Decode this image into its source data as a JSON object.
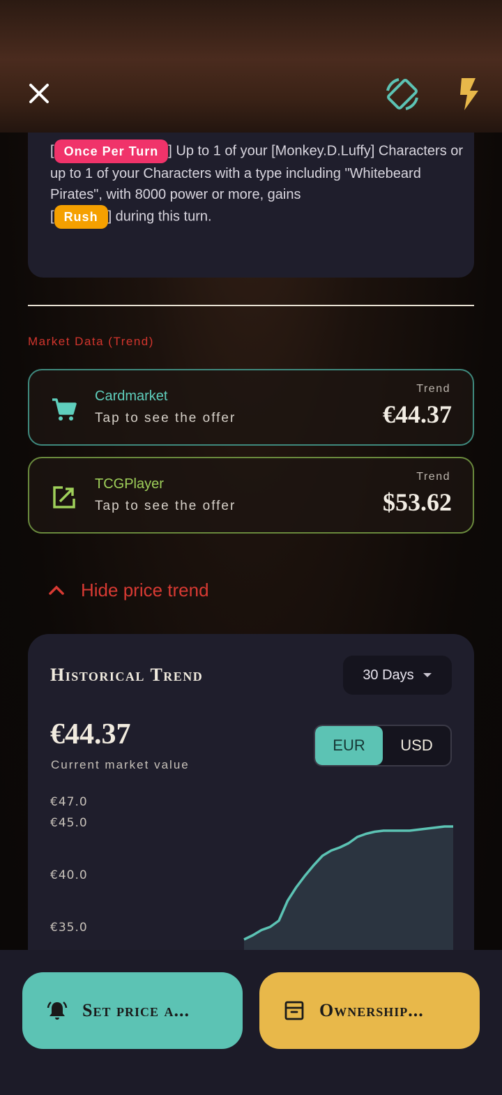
{
  "header": {
    "close_icon": "close-icon",
    "rotate_icon": "screen-rotation-icon",
    "flash_icon": "flash-icon"
  },
  "effect": {
    "tag1": "Once Per Turn",
    "text1": "] Up to 1 of your [Monkey.D.Luffy] Characters or up to 1 of your Characters with a type including \"Whitebeard Pirates\", with 8000 power or more, gains",
    "tag2": "Rush",
    "text2": "] during this turn.",
    "bracket_open": "[",
    "colors": {
      "once_per_turn": "#f0336a",
      "rush": "#f5a000"
    }
  },
  "market": {
    "section_label": "Market Data (Trend)",
    "cardmarket": {
      "name": "Cardmarket",
      "sub": "Tap to see the offer",
      "trend_label": "Trend",
      "price": "€44.37",
      "icon": "cart-icon"
    },
    "tcgplayer": {
      "name": "TCGPlayer",
      "sub": "Tap to see the offer",
      "trend_label": "Trend",
      "price": "$53.62",
      "icon": "external-link-icon"
    }
  },
  "price_trend_toggle": {
    "label": "Hide price trend",
    "icon": "chevron-up-icon"
  },
  "historical": {
    "title": "Historical Trend",
    "range": "30 Days",
    "current_value": "€44.37",
    "current_label": "Current market value",
    "currency": {
      "eur": "EUR",
      "usd": "USD",
      "selected": "EUR"
    }
  },
  "chart_data": {
    "type": "area",
    "yticks": [
      "€47.0",
      "€45.0",
      "€40.0",
      "€35.0"
    ],
    "ytick_values": [
      47.0,
      45.0,
      40.0,
      35.0
    ],
    "x": [
      1,
      2,
      3,
      4,
      5,
      6,
      7,
      8,
      9,
      10,
      11,
      12,
      13,
      14,
      15,
      16,
      17,
      18,
      19,
      20,
      21,
      22,
      23,
      24,
      25
    ],
    "values": [
      33.8,
      34.2,
      34.7,
      35.0,
      35.6,
      37.5,
      38.8,
      39.9,
      40.9,
      41.8,
      42.3,
      42.6,
      43.0,
      43.6,
      43.9,
      44.1,
      44.2,
      44.2,
      44.2,
      44.2,
      44.3,
      44.4,
      44.5,
      44.6,
      44.6
    ],
    "ylim": [
      33.5,
      47.0
    ],
    "color": "#5cc3b4"
  },
  "actions": {
    "price_alert": "Set price a...",
    "ownership": "Ownership...",
    "alert_icon": "bell-alert-icon",
    "ownership_icon": "archive-box-icon"
  }
}
